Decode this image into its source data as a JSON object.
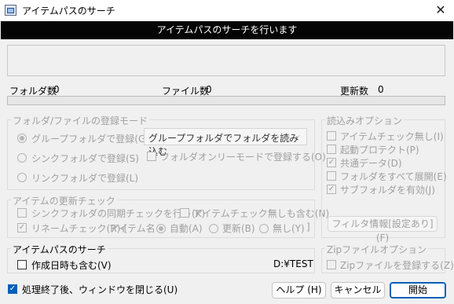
{
  "window": {
    "title": "アイテムパスのサーチ",
    "close_glyph": "✕"
  },
  "header": {
    "message": "アイテムパスのサーチを行います"
  },
  "counts": {
    "folders_label": "フォルダ数",
    "folders_value": "0",
    "files_label": "ファイル数",
    "files_value": "0",
    "updates_label": "更新数",
    "updates_value": "0"
  },
  "progress": {
    "value": 0
  },
  "register_mode": {
    "legend": "フォルダ/ファイルの登録モード",
    "options": [
      "グループフォルダで登録(G)",
      "シンクフォルダで登録(S)",
      "リンクフォルダで登録(L)"
    ],
    "selected_index": 0,
    "group_select_value": "グループフォルダでフォルダを読み込む",
    "folder_only_label": "フォルダオンリーモードで登録する(O)"
  },
  "update_check": {
    "legend": "アイテムの更新チェック",
    "sync_check_label": "シンクフォルダの同期チェックを行う(K)",
    "no_item_check_label": "アイテムチェック無しも含む(N)",
    "rename_label": "リネームチェック(R)-[",
    "item_name_label": "アイテム名：",
    "auto_label": "自動(A)",
    "update_label": "更新(B)",
    "none_label": "無し(Y)",
    "close_bracket": "]"
  },
  "read_options": {
    "legend": "読込みオプション",
    "items": [
      {
        "label": "アイテムチェック無し(I)",
        "checked": false
      },
      {
        "label": "起動プロテクト(P)",
        "checked": false
      },
      {
        "label": "共通データ(D)",
        "checked": true
      },
      {
        "label": "フォルダをすべて展開(E)",
        "checked": false
      },
      {
        "label": "サブフォルダを有効(J)",
        "checked": true
      }
    ],
    "filter_button": "フィルタ情報[設定あり](F)"
  },
  "item_path_search": {
    "legend": "アイテムパスのサーチ",
    "include_datetime_label": "作成日時も含む(V)",
    "path": "D:¥TEST"
  },
  "zip_options": {
    "legend": "Zipファイルオプション",
    "register_zip_label": "Zipファイルを登録する(Z)"
  },
  "footer": {
    "close_window_label": "処理終了後、ウィンドウを閉じる(U)",
    "close_window_checked": true,
    "help_button": "ヘルプ (H)",
    "cancel_button": "キャンセル",
    "start_button": "開始"
  },
  "colors": {
    "accent": "#005fb8",
    "header_bg": "#050505",
    "disabled_text": "#a0a0a0"
  }
}
